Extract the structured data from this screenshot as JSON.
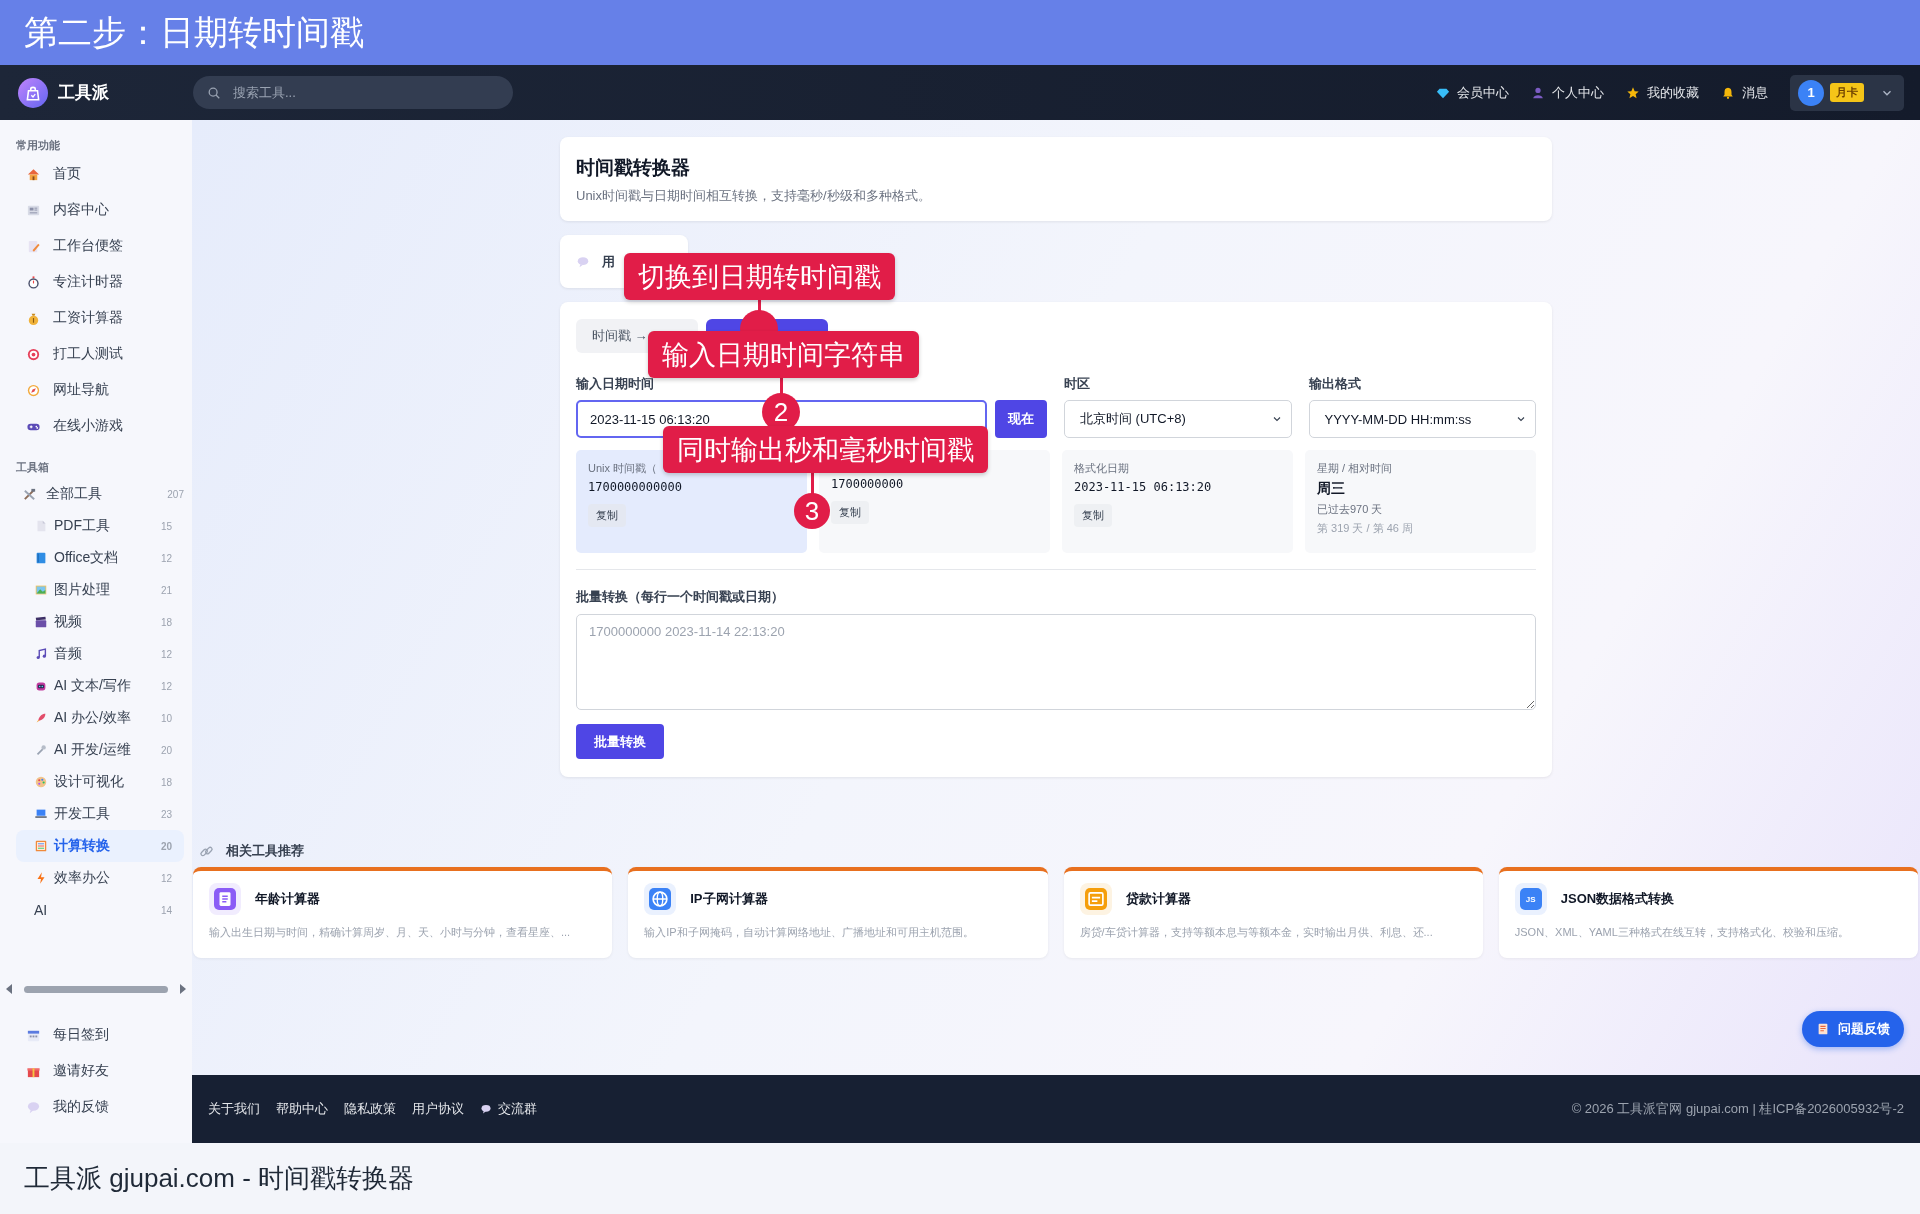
{
  "banner": {
    "title": "第二步：日期转时间戳"
  },
  "navbar": {
    "brand": "工具派",
    "search": {
      "placeholder": "搜索工具..."
    },
    "links": [
      {
        "label": "会员中心"
      },
      {
        "label": "个人中心"
      },
      {
        "label": "我的收藏"
      },
      {
        "label": "消息"
      }
    ],
    "user": {
      "avatar": "1",
      "badge": "月卡"
    }
  },
  "sidebar": {
    "sections": [
      {
        "title": "常用功能",
        "items": [
          {
            "label": "首页",
            "selected": false
          },
          {
            "label": "内容中心",
            "selected": false
          },
          {
            "label": "工作台便签",
            "selected": false
          },
          {
            "label": "专注计时器",
            "selected": false
          },
          {
            "label": "工资计算器",
            "selected": false
          },
          {
            "label": "打工人测试",
            "selected": false
          },
          {
            "label": "网址导航",
            "selected": false
          },
          {
            "label": "在线小游戏",
            "selected": false
          }
        ]
      },
      {
        "title": "工具箱",
        "items": [
          {
            "label": "全部工具",
            "count": "207",
            "selected": false,
            "children": [
              {
                "label": "PDF工具",
                "count": "15",
                "selected": false
              },
              {
                "label": "Office文档",
                "count": "12",
                "selected": false
              },
              {
                "label": "图片处理",
                "count": "21",
                "selected": false
              },
              {
                "label": "视频",
                "count": "18",
                "selected": false
              },
              {
                "label": "音频",
                "count": "12",
                "selected": false
              },
              {
                "label": "AI 文本/写作",
                "count": "12",
                "selected": false
              },
              {
                "label": "AI 办公/效率",
                "count": "10",
                "selected": false
              },
              {
                "label": "AI 开发/运维",
                "count": "20",
                "selected": false
              },
              {
                "label": "设计可视化",
                "count": "18",
                "selected": false
              },
              {
                "label": "开发工具",
                "count": "23",
                "selected": false
              },
              {
                "label": "计算转换",
                "count": "20",
                "selected": true
              },
              {
                "label": "效率办公",
                "count": "12",
                "selected": false
              },
              {
                "label": "AI",
                "count": "14",
                "selected": false
              }
            ]
          }
        ]
      }
    ],
    "bottom_items": [
      {
        "label": "每日签到"
      },
      {
        "label": "邀请好友"
      },
      {
        "label": "我的反馈"
      }
    ]
  },
  "header_card": {
    "title": "时间戳转换器",
    "description": "Unix时间戳与日期时间相互转换，支持毫秒/秒级和多种格式。"
  },
  "notice_card": {
    "text": "用"
  },
  "tool": {
    "tabs": [
      {
        "label": "时间戳 →",
        "selected": false
      },
      {
        "selected": true
      }
    ],
    "date_input": {
      "label": "输入日期时间",
      "value": "2023-11-15 06:13:20"
    },
    "now_button": "现在",
    "timezone": {
      "label": "时区",
      "value": "北京时间 (UTC+8)"
    },
    "output_format": {
      "label": "输出格式",
      "value": "YYYY-MM-DD HH:mm:ss"
    },
    "results": [
      {
        "kind": "copy",
        "label": "Unix 时间戳（",
        "value": "1700000000000",
        "action": "复制",
        "selected": true
      },
      {
        "kind": "copy",
        "value": "1700000000",
        "action": "复制",
        "selected": false
      },
      {
        "kind": "copy",
        "label": "格式化日期",
        "value": "2023-11-15 06:13:20",
        "action": "复制",
        "selected": false
      },
      {
        "kind": "info",
        "label": "星期 / 相对时间",
        "value": "周三",
        "lines": [
          "已过去970 天",
          "第 319 天 / 第 46 周"
        ],
        "selected": false
      }
    ],
    "batch": {
      "label": "批量转换（每行一个时间戳或日期）",
      "placeholder": "1700000000 2023-11-14 22:13:20",
      "button": "批量转换"
    }
  },
  "callouts": [
    {
      "text": "切换到日期转时间戳"
    },
    {
      "text": "输入日期时间字符串",
      "number": "2"
    },
    {
      "text": "同时输出秒和毫秒时间戳",
      "number": "3"
    }
  ],
  "related": {
    "title": "相关工具推荐",
    "cards": [
      {
        "title": "年龄计算器",
        "description": "输入出生日期与时间，精确计算周岁、月、天、小时与分钟，查看星座、..."
      },
      {
        "title": "IP子网计算器",
        "description": "输入IP和子网掩码，自动计算网络地址、广播地址和可用主机范围。"
      },
      {
        "title": "贷款计算器",
        "description": "房贷/车贷计算器，支持等额本息与等额本金，实时输出月供、利息、还..."
      },
      {
        "title": "JSON数据格式转换",
        "icon_text": "JS",
        "description": "JSON、XML、YAML三种格式在线互转，支持格式化、校验和压缩。"
      }
    ]
  },
  "feedback_button": "问题反馈",
  "footer": {
    "links": [
      {
        "label": "关于我们"
      },
      {
        "label": "帮助中心"
      },
      {
        "label": "隐私政策"
      },
      {
        "label": "用户协议"
      },
      {
        "label": "交流群",
        "icon": true
      }
    ],
    "copyright": "© 2026 工具派官网 gjupai.com | 桂ICP备2026005932号-2"
  },
  "caption": "工具派 gjupai.com - 时间戳转换器"
}
